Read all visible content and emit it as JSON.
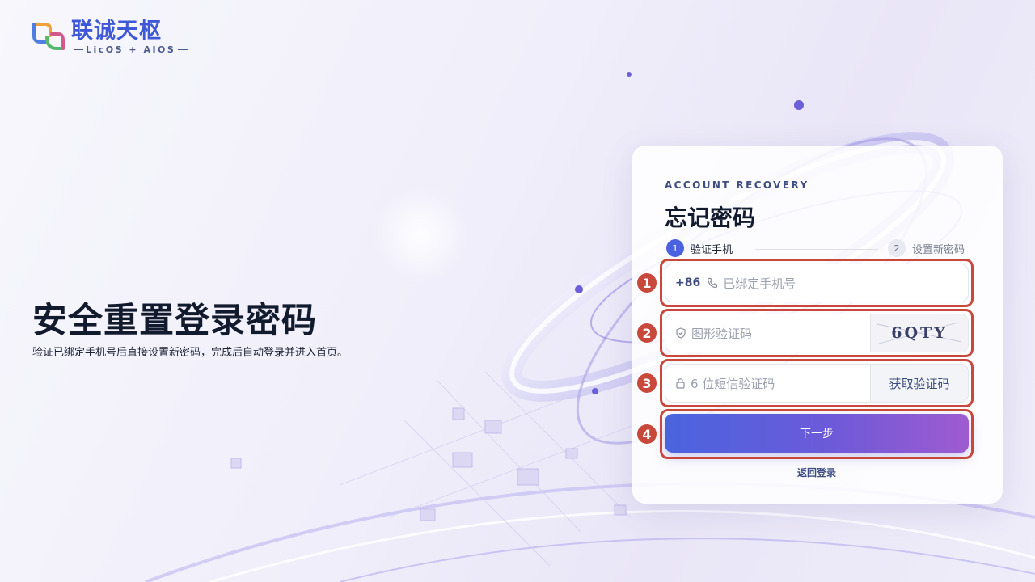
{
  "brand": {
    "name": "联诚天枢",
    "subtitle": "LicOS + AIOS"
  },
  "hero": {
    "title": "安全重置登录密码",
    "subtitle": "验证已绑定手机号后直接设置新密码，完成后自动登录并进入首页。"
  },
  "card": {
    "eyebrow": "ACCOUNT RECOVERY",
    "title": "忘记密码",
    "steps": [
      {
        "number": "1",
        "label": "验证手机",
        "active": true
      },
      {
        "number": "2",
        "label": "设置新密码",
        "active": false
      }
    ],
    "phone": {
      "prefix": "+86",
      "placeholder": "已绑定手机号",
      "icon": "phone-icon"
    },
    "captcha": {
      "placeholder": "图形验证码",
      "code": "6QTY",
      "icon": "shield-icon"
    },
    "sms": {
      "placeholder": "6 位短信验证码",
      "button": "获取验证码",
      "icon": "lock-icon"
    },
    "next_button": "下一步",
    "back_link": "返回登录"
  },
  "annotations": [
    "1",
    "2",
    "3",
    "4"
  ],
  "colors": {
    "primary": "#4a62e0",
    "gradient_end": "#9f5bd0",
    "highlight": "#c8493c",
    "title": "#121a2e"
  }
}
